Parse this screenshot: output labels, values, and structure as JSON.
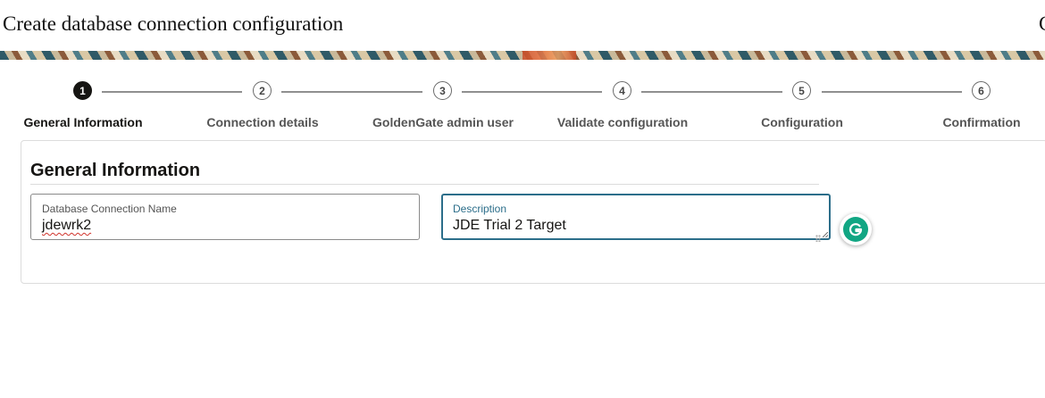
{
  "page": {
    "title": "Create database connection configuration",
    "title_overflow": "C"
  },
  "stepper": {
    "steps": [
      {
        "number": "1",
        "label": "General Information",
        "active": true
      },
      {
        "number": "2",
        "label": "Connection details",
        "active": false
      },
      {
        "number": "3",
        "label": "GoldenGate admin user",
        "active": false
      },
      {
        "number": "4",
        "label": "Validate configuration",
        "active": false
      },
      {
        "number": "5",
        "label": "Configuration",
        "active": false
      },
      {
        "number": "6",
        "label": "Confirmation",
        "active": false
      }
    ]
  },
  "general_information": {
    "section_title": "General Information",
    "connection_name": {
      "label": "Database Connection Name",
      "value": "jdewrk2"
    },
    "description": {
      "label": "Description",
      "value": "JDE Trial 2 Target"
    }
  },
  "colors": {
    "active_step": "#161513",
    "focus_border": "#2c6e8a",
    "grammarly_green": "#11a683"
  },
  "icons": {
    "grammarly": "grammarly-icon"
  }
}
